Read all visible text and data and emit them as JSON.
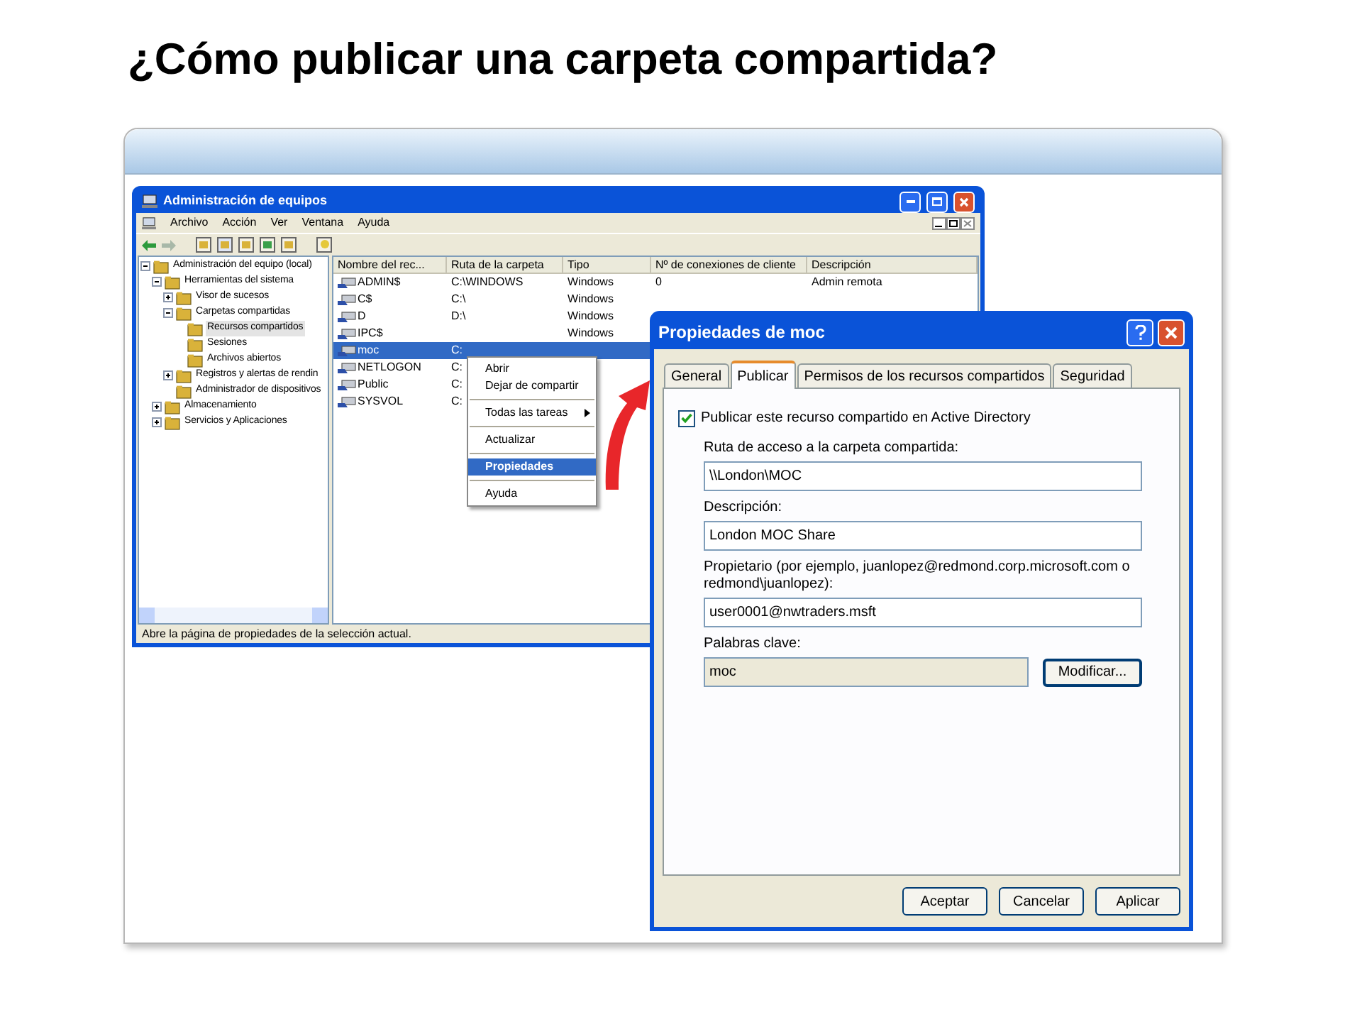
{
  "slide_title": "¿Cómo publicar una carpeta compartida?",
  "management_window": {
    "title": "Administración de equipos",
    "menu": [
      "Archivo",
      "Acción",
      "Ver",
      "Ventana",
      "Ayuda"
    ],
    "tree": [
      {
        "label": "Administración del equipo (local)",
        "expanded": true,
        "selected": false,
        "children": [
          {
            "label": "Herramientas del sistema",
            "expanded": true,
            "selected": false,
            "children": [
              {
                "label": "Visor de sucesos",
                "expanded": false,
                "selected": false
              },
              {
                "label": "Carpetas compartidas",
                "expanded": true,
                "selected": false,
                "children": [
                  {
                    "label": "Recursos compartidos",
                    "selected": true
                  },
                  {
                    "label": "Sesiones",
                    "selected": false
                  },
                  {
                    "label": "Archivos abiertos",
                    "selected": false
                  }
                ]
              },
              {
                "label": "Registros y alertas de rendin",
                "expanded": false,
                "selected": false
              },
              {
                "label": "Administrador de dispositivos",
                "selected": false
              }
            ]
          },
          {
            "label": "Almacenamiento",
            "expanded": false,
            "selected": false
          },
          {
            "label": "Servicios y Aplicaciones",
            "expanded": false,
            "selected": false
          }
        ]
      }
    ],
    "columns": [
      "Nombre del rec...",
      "Ruta de la carpeta",
      "Tipo",
      "Nº de conexiones de cliente",
      "Descripción"
    ],
    "rows": [
      {
        "cells": [
          "ADMIN$",
          "C:\\WINDOWS",
          "Windows",
          "0",
          "Admin remota"
        ],
        "selected": false
      },
      {
        "cells": [
          "C$",
          "C:\\",
          "Windows"
        ],
        "selected": false
      },
      {
        "cells": [
          "D",
          "D:\\",
          "Windows"
        ],
        "selected": false
      },
      {
        "cells": [
          "IPC$",
          "",
          "Windows"
        ],
        "selected": false
      },
      {
        "cells": [
          "moc",
          "C:"
        ],
        "selected": true
      },
      {
        "cells": [
          "NETLOGON",
          "C:"
        ],
        "selected": false
      },
      {
        "cells": [
          "Public",
          "C:"
        ],
        "selected": false
      },
      {
        "cells": [
          "SYSVOL",
          "C:"
        ],
        "selected": false
      }
    ],
    "status_bar": "Abre la página de propiedades de la selección actual."
  },
  "context_menu": [
    {
      "kind": "item",
      "label": "Abrir",
      "selected": false
    },
    {
      "kind": "item",
      "label": "Dejar de compartir",
      "selected": false
    },
    {
      "kind": "separator"
    },
    {
      "kind": "submenu",
      "label": "Todas las tareas",
      "selected": false
    },
    {
      "kind": "separator"
    },
    {
      "kind": "item",
      "label": "Actualizar",
      "selected": false
    },
    {
      "kind": "separator"
    },
    {
      "kind": "item",
      "label": "Propiedades",
      "selected": true
    },
    {
      "kind": "separator"
    },
    {
      "kind": "item",
      "label": "Ayuda",
      "selected": false
    }
  ],
  "properties_dialog": {
    "title": "Propiedades de moc",
    "tabs": [
      {
        "label": "General",
        "selected": false
      },
      {
        "label": "Publicar",
        "selected": true
      },
      {
        "label": "Permisos de los recursos compartidos",
        "selected": false
      },
      {
        "label": "Seguridad",
        "selected": false
      }
    ],
    "publish_checkbox": {
      "label": "Publicar este recurso compartido en Active Directory",
      "checked": true
    },
    "fields": [
      {
        "label": "Ruta de acceso a la carpeta compartida:",
        "value": "\\\\London\\MOC",
        "readonly": false
      },
      {
        "label": "Descripción:",
        "value": "London MOC Share",
        "readonly": false
      },
      {
        "label": "Propietario (por ejemplo, juanlopez@redmond.corp.microsoft.com o redmond\\juanlopez):",
        "value": "user0001@nwtraders.msft",
        "readonly": false
      },
      {
        "label": "Palabras clave:",
        "value": "moc",
        "readonly": true,
        "button": "Modificar..."
      }
    ],
    "buttons": [
      "Aceptar",
      "Cancelar",
      "Aplicar"
    ]
  }
}
